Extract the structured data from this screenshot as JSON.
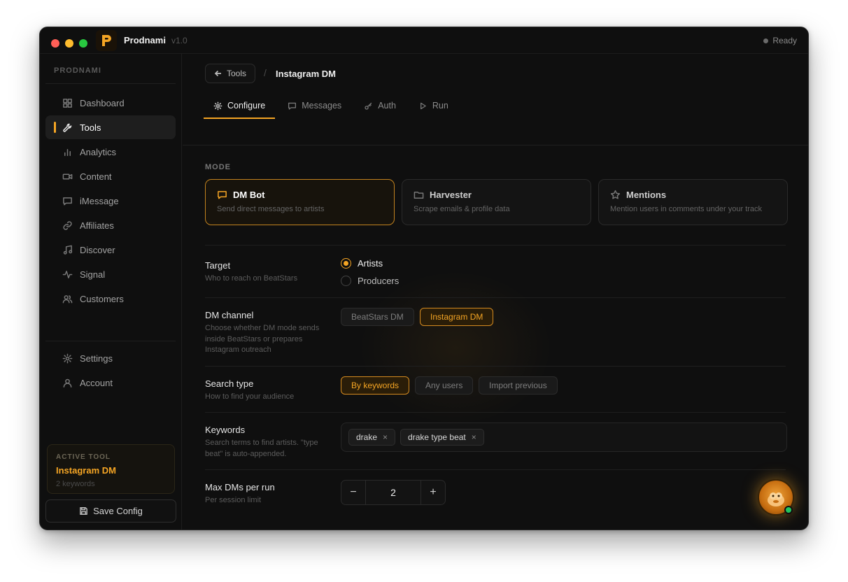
{
  "app": {
    "title": "Prodnami",
    "version": "v1.0",
    "status": "Ready",
    "logo_letter": "P"
  },
  "sidebar": {
    "brand": "PRODNAMI",
    "items": [
      {
        "label": "Dashboard",
        "icon": "grid-icon"
      },
      {
        "label": "Tools",
        "icon": "wrench-icon",
        "active": true
      },
      {
        "label": "Analytics",
        "icon": "bar-chart-icon"
      },
      {
        "label": "Content",
        "icon": "video-icon"
      },
      {
        "label": "iMessage",
        "icon": "message-icon"
      },
      {
        "label": "Affiliates",
        "icon": "link-icon"
      },
      {
        "label": "Discover",
        "icon": "music-icon"
      },
      {
        "label": "Signal",
        "icon": "activity-icon"
      },
      {
        "label": "Customers",
        "icon": "users-icon"
      }
    ],
    "bottom_items": [
      {
        "label": "Settings",
        "icon": "gear-icon"
      },
      {
        "label": "Account",
        "icon": "user-icon"
      }
    ],
    "active_tool": {
      "label": "ACTIVE TOOL",
      "name": "Instagram DM",
      "sub": "2 keywords"
    },
    "save_label": "Save Config"
  },
  "header": {
    "back_label": "Tools",
    "separator": "/",
    "current": "Instagram DM"
  },
  "tabs": [
    {
      "label": "Configure",
      "icon": "gear-icon",
      "active": true
    },
    {
      "label": "Messages",
      "icon": "message-icon"
    },
    {
      "label": "Auth",
      "icon": "key-icon"
    },
    {
      "label": "Run",
      "icon": "play-icon"
    }
  ],
  "mode": {
    "label": "MODE",
    "cards": [
      {
        "title": "DM Bot",
        "desc": "Send direct messages to artists",
        "icon": "message-icon",
        "active": true
      },
      {
        "title": "Harvester",
        "desc": "Scrape emails & profile data",
        "icon": "folder-icon"
      },
      {
        "title": "Mentions",
        "desc": "Mention users in comments under your track",
        "icon": "star-icon"
      }
    ]
  },
  "target": {
    "title": "Target",
    "desc": "Who to reach on BeatStars",
    "options": [
      "Artists",
      "Producers"
    ],
    "selected": "Artists"
  },
  "dm_channel": {
    "title": "DM channel",
    "desc": "Choose whether DM mode sends inside BeatStars or prepares Instagram outreach",
    "options": [
      "BeatStars DM",
      "Instagram DM"
    ],
    "selected": "Instagram DM"
  },
  "search_type": {
    "title": "Search type",
    "desc": "How to find your audience",
    "options": [
      "By keywords",
      "Any users",
      "Import previous"
    ],
    "selected": "By keywords"
  },
  "keywords": {
    "title": "Keywords",
    "desc": "Search terms to find artists. \"type beat\" is auto-appended.",
    "chips": [
      "drake",
      "drake type beat"
    ],
    "remove_glyph": "×"
  },
  "max_dms": {
    "title": "Max DMs per run",
    "desc": "Per session limit",
    "value": "2",
    "minus": "−",
    "plus": "+"
  },
  "colors": {
    "accent": "#f5a524",
    "background": "#0f0f0f",
    "online": "#22c55e"
  }
}
